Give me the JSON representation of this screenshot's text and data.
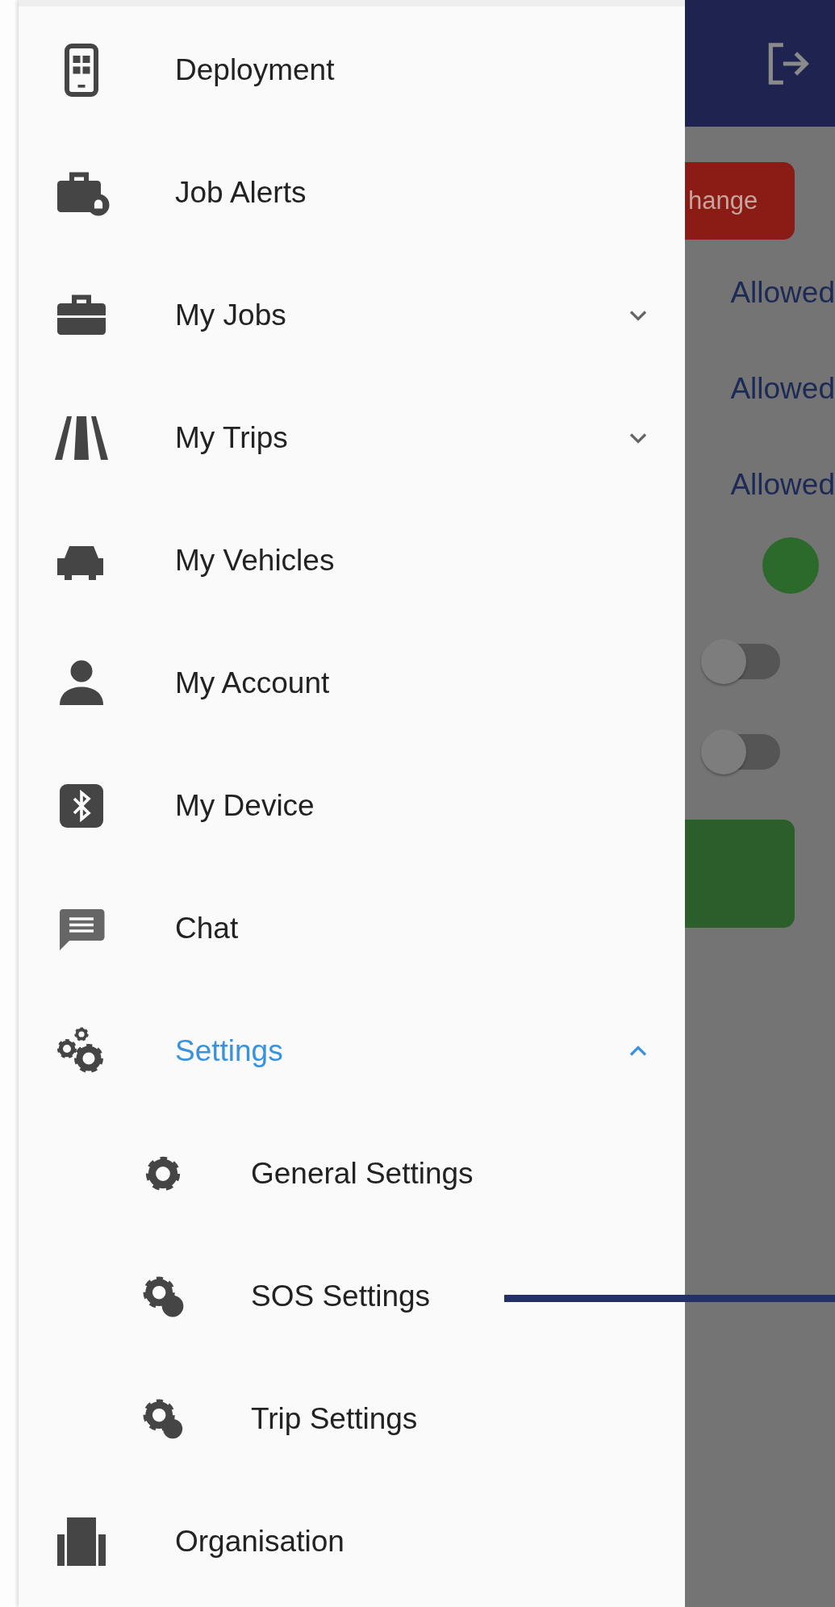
{
  "drawer": {
    "items": [
      {
        "label": "Deployment",
        "selected": false
      },
      {
        "label": "Job Alerts",
        "selected": false
      },
      {
        "label": "My Jobs",
        "selected": false,
        "expanded": false
      },
      {
        "label": "My Trips",
        "selected": false,
        "expanded": false
      },
      {
        "label": "My Vehicles",
        "selected": false
      },
      {
        "label": "My Account",
        "selected": false
      },
      {
        "label": "My Device",
        "selected": false
      },
      {
        "label": "Chat",
        "selected": false
      },
      {
        "label": "Settings",
        "selected": true,
        "expanded": true,
        "children": [
          {
            "label": "General Settings",
            "selected": false
          },
          {
            "label": "SOS Settings",
            "selected": false
          },
          {
            "label": "Trip Settings",
            "selected": false
          }
        ]
      },
      {
        "label": "Organisation",
        "selected": false
      }
    ]
  },
  "background": {
    "button_label": "hange",
    "permissions": [
      "Allowed",
      "Allowed",
      "Allowed"
    ],
    "toggles": [
      {
        "on": false
      },
      {
        "on": false
      }
    ]
  }
}
